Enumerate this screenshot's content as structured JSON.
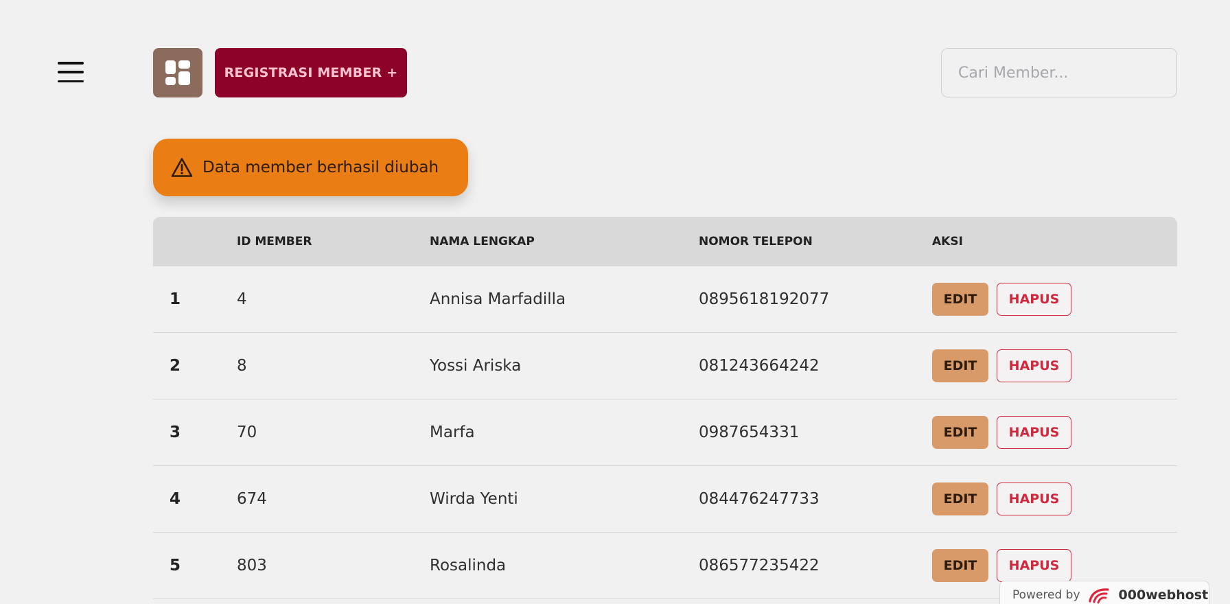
{
  "header": {
    "menu_icon": "hamburger-menu-icon",
    "dashboard_icon": "dashboard-grid-icon",
    "register_button": "REGISTRASI MEMBER +",
    "search_placeholder": "Cari Member...",
    "search_value": ""
  },
  "alert": {
    "icon": "warning-triangle-icon",
    "message": "Data member berhasil diubah",
    "color": "#ea7d14"
  },
  "table": {
    "columns": [
      "",
      "ID MEMBER",
      "NAMA LENGKAP",
      "NOMOR TELEPON",
      "AKSI"
    ],
    "rows": [
      {
        "no": "1",
        "id": "4",
        "name": "Annisa Marfadilla",
        "phone": "0895618192077",
        "edit": "EDIT",
        "delete": "HAPUS"
      },
      {
        "no": "2",
        "id": "8",
        "name": "Yossi Ariska",
        "phone": "081243664242",
        "edit": "EDIT",
        "delete": "HAPUS"
      },
      {
        "no": "3",
        "id": "70",
        "name": "Marfa",
        "phone": "0987654331",
        "edit": "EDIT",
        "delete": "HAPUS"
      },
      {
        "no": "4",
        "id": "674",
        "name": "Wirda Yenti",
        "phone": "084476247733",
        "edit": "EDIT",
        "delete": "HAPUS"
      },
      {
        "no": "5",
        "id": "803",
        "name": "Rosalinda",
        "phone": "086577235422",
        "edit": "EDIT",
        "delete": "HAPUS"
      }
    ]
  },
  "footer_badge": {
    "powered_by": "Powered by",
    "host_name": "000webhost",
    "icon": "000webhost-logo-icon"
  },
  "colors": {
    "background": "#f1f1f1",
    "register_button": "#8c0229",
    "dashboard_button": "#8b6c5c",
    "edit_button": "#d79a68",
    "delete_border": "#d1283e",
    "table_header": "#d9d9d9"
  }
}
